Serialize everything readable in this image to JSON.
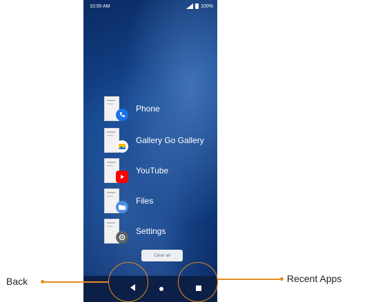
{
  "status_bar": {
    "time": "10:00 AM",
    "battery": "100%"
  },
  "recent_apps": [
    {
      "label": "Phone",
      "icon": "phone-icon",
      "badge_color": "#1a73e8"
    },
    {
      "label": "Gallery Go Gallery",
      "icon": "gallery-icon",
      "badge_color": "#ffffff"
    },
    {
      "label": "YouTube",
      "icon": "youtube-icon",
      "badge_color": "#ff0000"
    },
    {
      "label": "Files",
      "icon": "files-icon",
      "badge_color": "#4a90e2"
    },
    {
      "label": "Settings",
      "icon": "gear-icon",
      "badge_color": "#5f6368"
    }
  ],
  "clear_all_label": "Clear all",
  "nav": {
    "back": "back-icon",
    "home": "home-icon",
    "recent": "recent-apps-icon"
  },
  "callouts": {
    "back": "Back",
    "recent": "Recent Apps"
  },
  "colors": {
    "callout": "#e88a1f"
  }
}
